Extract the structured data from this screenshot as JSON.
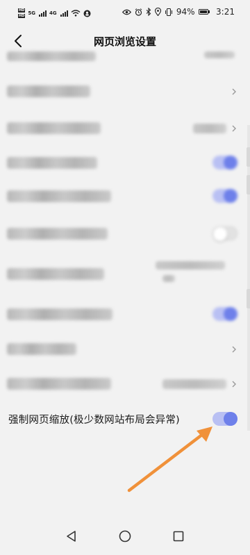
{
  "status_bar": {
    "network_labels": [
      "5G",
      "4G"
    ],
    "hd_labels": [
      "HD",
      "HD"
    ],
    "battery": "94%",
    "time": "3:21",
    "icons": [
      "eye-icon",
      "alarm-icon",
      "bluetooth-icon",
      "location-icon",
      "vibrate-icon",
      "battery-icon"
    ]
  },
  "header": {
    "title": "网页浏览设置",
    "back_icon": "back-arrow-icon"
  },
  "settings": {
    "items": [
      {
        "label": "",
        "control": "value",
        "blurred": true
      },
      {
        "label": "",
        "control": "chevron",
        "blurred": true
      },
      {
        "label": "",
        "control": "value-chevron",
        "blurred": true
      },
      {
        "label": "",
        "control": "toggle",
        "state": "on",
        "blurred": true
      },
      {
        "label": "",
        "control": "toggle",
        "state": "on",
        "blurred": true
      },
      {
        "label": "",
        "control": "toggle",
        "state": "off",
        "blurred": true
      },
      {
        "label": "",
        "control": "value",
        "blurred": true
      },
      {
        "label": "",
        "control": "toggle",
        "state": "on",
        "blurred": true
      },
      {
        "label": "",
        "control": "chevron",
        "blurred": true
      },
      {
        "label": "",
        "control": "value-chevron",
        "blurred": true
      }
    ],
    "visible_item": {
      "label": "强制网页缩放(极少数网站布局会异常)",
      "control": "toggle",
      "state": "on"
    }
  },
  "colors": {
    "accent": "#6e80ea",
    "accent_track": "#b9c0f3",
    "annotation_arrow": "#f0913a",
    "background": "#f2f2f2"
  },
  "nav_bar": {
    "icons": [
      "back-triangle-icon",
      "home-circle-icon",
      "recents-square-icon"
    ]
  }
}
